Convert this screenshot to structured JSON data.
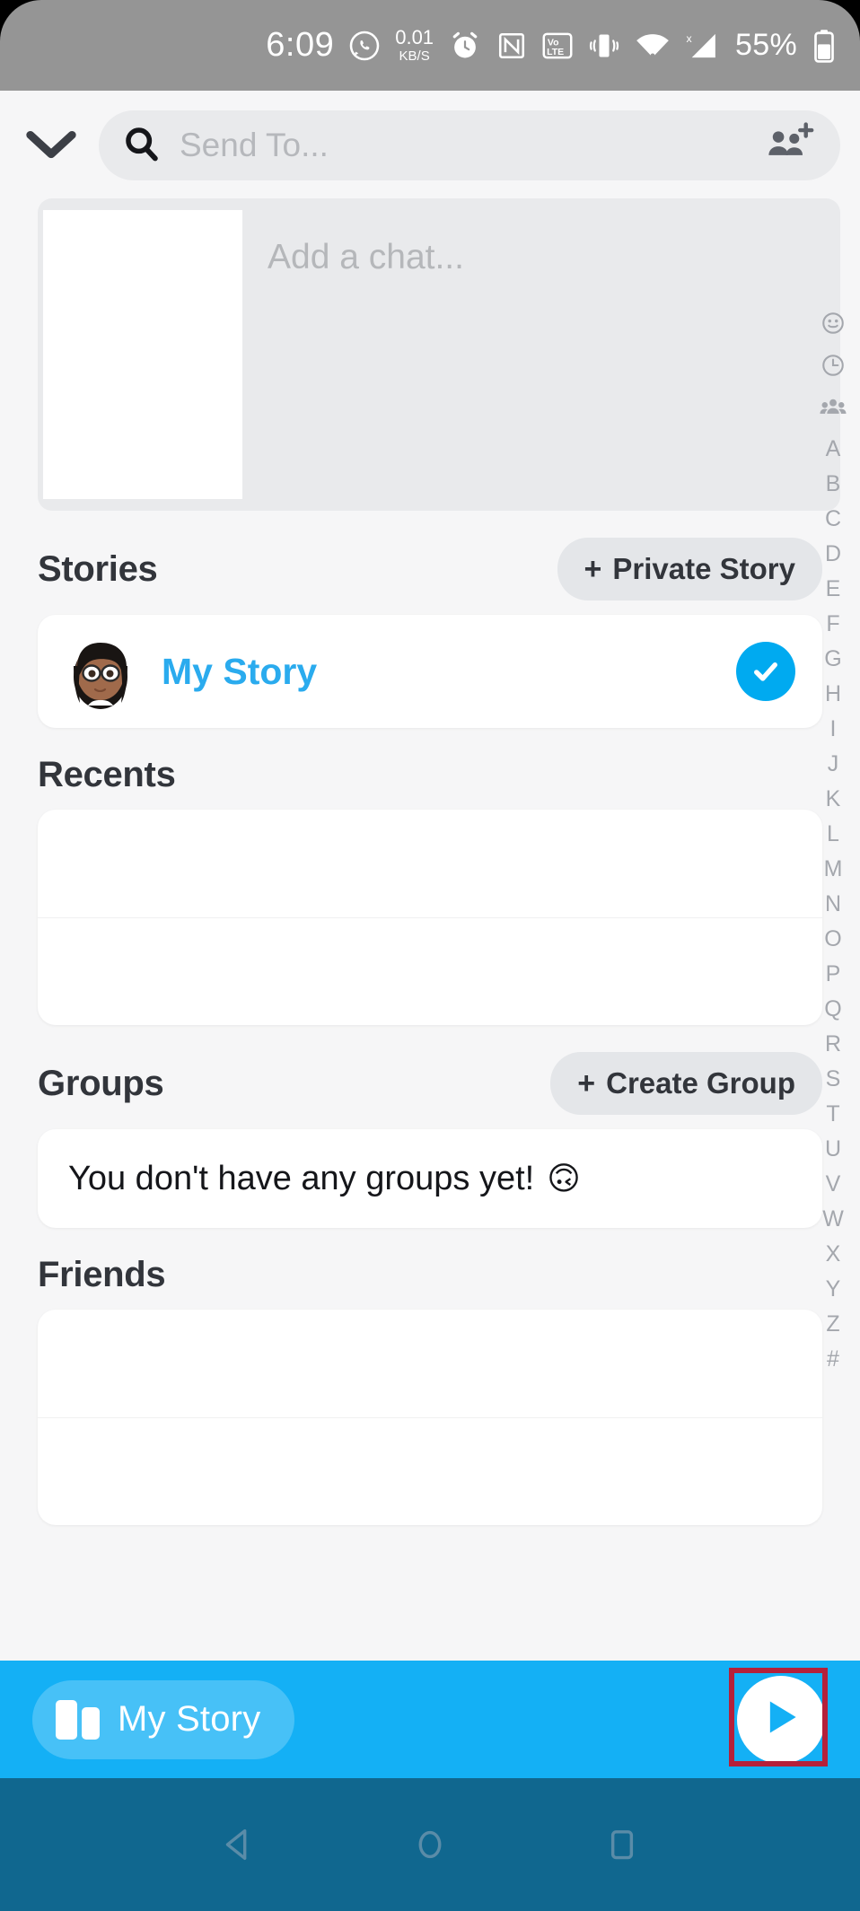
{
  "status_bar": {
    "time": "6:09",
    "whatsapp_icon": "whatsapp-icon",
    "net_speed_value": "0.01",
    "net_speed_unit": "KB/S",
    "alarm_icon": "alarm-clock-icon",
    "nfc_icon": "nfc-icon",
    "volte_top": "Vo",
    "volte_bottom": "LTE",
    "vibrate_icon": "vibrate-icon",
    "wifi_icon": "wifi-icon",
    "signal_icon": "signal-no-service-icon",
    "battery_percent": "55%",
    "battery_icon": "battery-icon",
    "background_color": "#959595"
  },
  "header": {
    "collapse_icon": "chevron-down-icon",
    "search": {
      "icon": "search-icon",
      "placeholder": "Send To...",
      "value": ""
    },
    "add_friends_icon": "add-friends-icon"
  },
  "chat_preview": {
    "thumbnail": "snap-thumbnail",
    "placeholder": "Add a chat..."
  },
  "sections": {
    "stories": {
      "title": "Stories",
      "action": {
        "plus": "+",
        "label": "Private Story"
      },
      "items": [
        {
          "avatar": "bitmoji-avatar",
          "name": "My Story",
          "selected": true,
          "check_icon": "check-icon"
        }
      ]
    },
    "recents": {
      "title": "Recents",
      "items": []
    },
    "groups": {
      "title": "Groups",
      "action": {
        "plus": "+",
        "label": "Create Group"
      },
      "empty_text": "You don't have any groups yet!",
      "empty_emoji": "🙃"
    },
    "friends": {
      "title": "Friends",
      "items": []
    }
  },
  "index_rail": {
    "icons": [
      "smiley-icon",
      "clock-icon",
      "group-icon"
    ],
    "letters": [
      "A",
      "B",
      "C",
      "D",
      "E",
      "F",
      "G",
      "H",
      "I",
      "J",
      "K",
      "L",
      "M",
      "N",
      "O",
      "P",
      "Q",
      "R",
      "S",
      "T",
      "U",
      "V",
      "W",
      "X",
      "Y",
      "Z",
      "#"
    ]
  },
  "action_bar": {
    "background_color": "#14b0f5",
    "my_story": {
      "icon": "story-cards-icon",
      "label": "My Story"
    },
    "send_button": {
      "icon": "send-arrow-icon",
      "highlighted": true,
      "highlight_color": "#b5203a"
    }
  },
  "nav_bar": {
    "background_color": "#10678f",
    "buttons": [
      "back-icon",
      "home-icon",
      "recents-icon"
    ]
  },
  "colors": {
    "accent_blue": "#00aaf0",
    "action_blue": "#14b0f5",
    "page_background": "#f6f6f7",
    "card_background": "#ffffff"
  }
}
